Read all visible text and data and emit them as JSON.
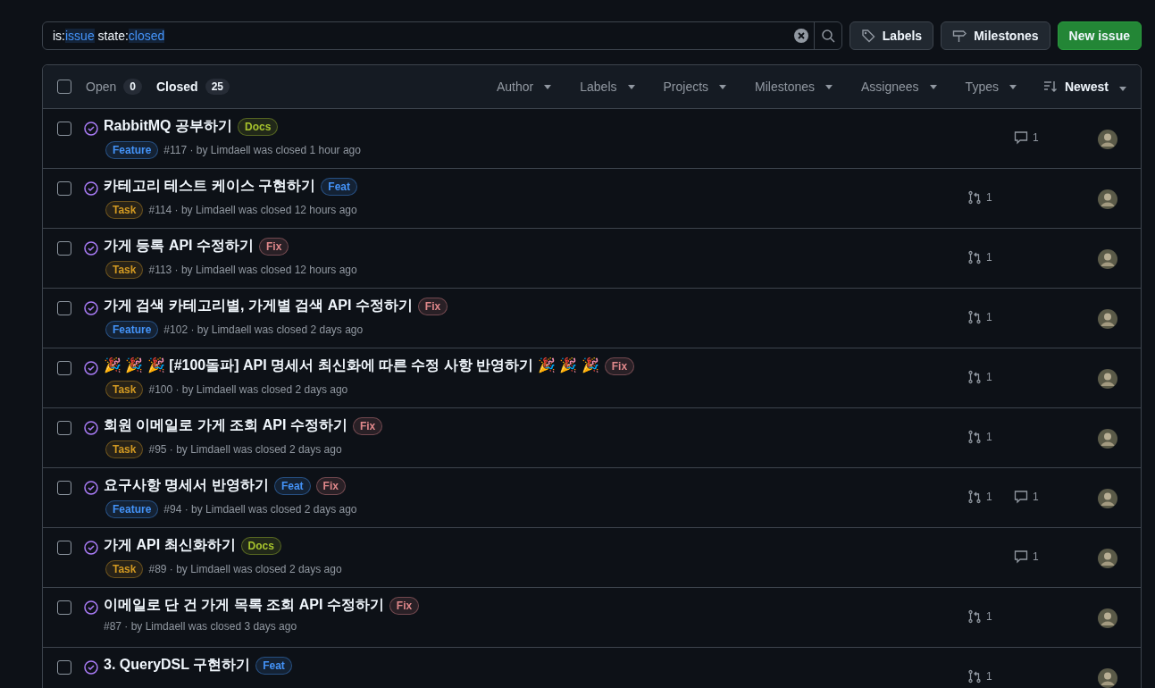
{
  "search": {
    "tokens": [
      {
        "key": "is:",
        "value": "issue"
      },
      {
        "key": "state:",
        "value": "closed"
      }
    ]
  },
  "actions": [
    {
      "kind": "labels",
      "label": "Labels"
    },
    {
      "kind": "milestones",
      "label": "Milestones"
    },
    {
      "kind": "primary",
      "label": "New issue"
    }
  ],
  "header": {
    "checked": false,
    "tabs": [
      {
        "label": "Open",
        "count": "0",
        "selected": false
      },
      {
        "label": "Closed",
        "count": "25",
        "selected": true
      }
    ],
    "filters": [
      "Author",
      "Labels",
      "Projects",
      "Milestones",
      "Assignees",
      "Types"
    ],
    "sort": "Newest"
  },
  "issues": [
    {
      "checked": false,
      "title": "RabbitMQ 공부하기",
      "labels": [
        {
          "text": "Docs",
          "color": "#a6c22d"
        }
      ],
      "type": {
        "text": "Feature",
        "color": "#4493f8"
      },
      "meta": "#117 · by Limdaell was closed 1 hour ago",
      "comments": "1"
    },
    {
      "checked": false,
      "title": "카테고리 테스트 케이스 구현하기",
      "labels": [
        {
          "text": "Feat",
          "color": "#4493f8"
        }
      ],
      "type": {
        "text": "Task",
        "color": "#d29922"
      },
      "meta": "#114 · by Limdaell was closed 12 hours ago",
      "prs": "1"
    },
    {
      "checked": false,
      "title": "가게 등록 API 수정하기",
      "labels": [
        {
          "text": "Fix",
          "color": "#e0888b"
        }
      ],
      "type": {
        "text": "Task",
        "color": "#d29922"
      },
      "meta": "#113 · by Limdaell was closed 12 hours ago",
      "prs": "1"
    },
    {
      "checked": false,
      "title": "가게 검색 카테고리별, 가게별 검색 API 수정하기",
      "labels": [
        {
          "text": "Fix",
          "color": "#e0888b"
        }
      ],
      "type": {
        "text": "Feature",
        "color": "#4493f8"
      },
      "meta": "#102 · by Limdaell was closed 2 days ago",
      "prs": "1"
    },
    {
      "checked": false,
      "title": "🎉 🎉 🎉 [#100돌파] API 명세서 최신화에 따른 수정 사항 반영하기 🎉 🎉 🎉",
      "labels": [
        {
          "text": "Fix",
          "color": "#e0888b"
        }
      ],
      "type": {
        "text": "Task",
        "color": "#d29922"
      },
      "meta": "#100 · by Limdaell was closed 2 days ago",
      "prs": "1"
    },
    {
      "checked": false,
      "title": "회원 이메일로 가게 조회 API 수정하기",
      "labels": [
        {
          "text": "Fix",
          "color": "#e0888b"
        }
      ],
      "type": {
        "text": "Task",
        "color": "#d29922"
      },
      "meta": "#95 · by Limdaell was closed 2 days ago",
      "prs": "1"
    },
    {
      "checked": false,
      "title": "요구사항 명세서 반영하기",
      "labels": [
        {
          "text": "Feat",
          "color": "#4493f8"
        },
        {
          "text": "Fix",
          "color": "#e0888b"
        }
      ],
      "type": {
        "text": "Feature",
        "color": "#4493f8"
      },
      "meta": "#94 · by Limdaell was closed 2 days ago",
      "prs": "1",
      "comments": "1"
    },
    {
      "checked": false,
      "title": "가게 API 최신화하기",
      "labels": [
        {
          "text": "Docs",
          "color": "#a6c22d"
        }
      ],
      "type": {
        "text": "Task",
        "color": "#d29922"
      },
      "meta": "#89 · by Limdaell was closed 2 days ago",
      "comments": "1"
    },
    {
      "checked": false,
      "title": "이메일로 단 건 가게 목록 조회 API 수정하기",
      "labels": [
        {
          "text": "Fix",
          "color": "#e0888b"
        }
      ],
      "meta": "#87 · by Limdaell was closed 3 days ago",
      "prs": "1"
    },
    {
      "checked": false,
      "title": "3. QueryDSL 구현하기",
      "labels": [
        {
          "text": "Feat",
          "color": "#4493f8"
        }
      ],
      "prs": "1"
    }
  ]
}
